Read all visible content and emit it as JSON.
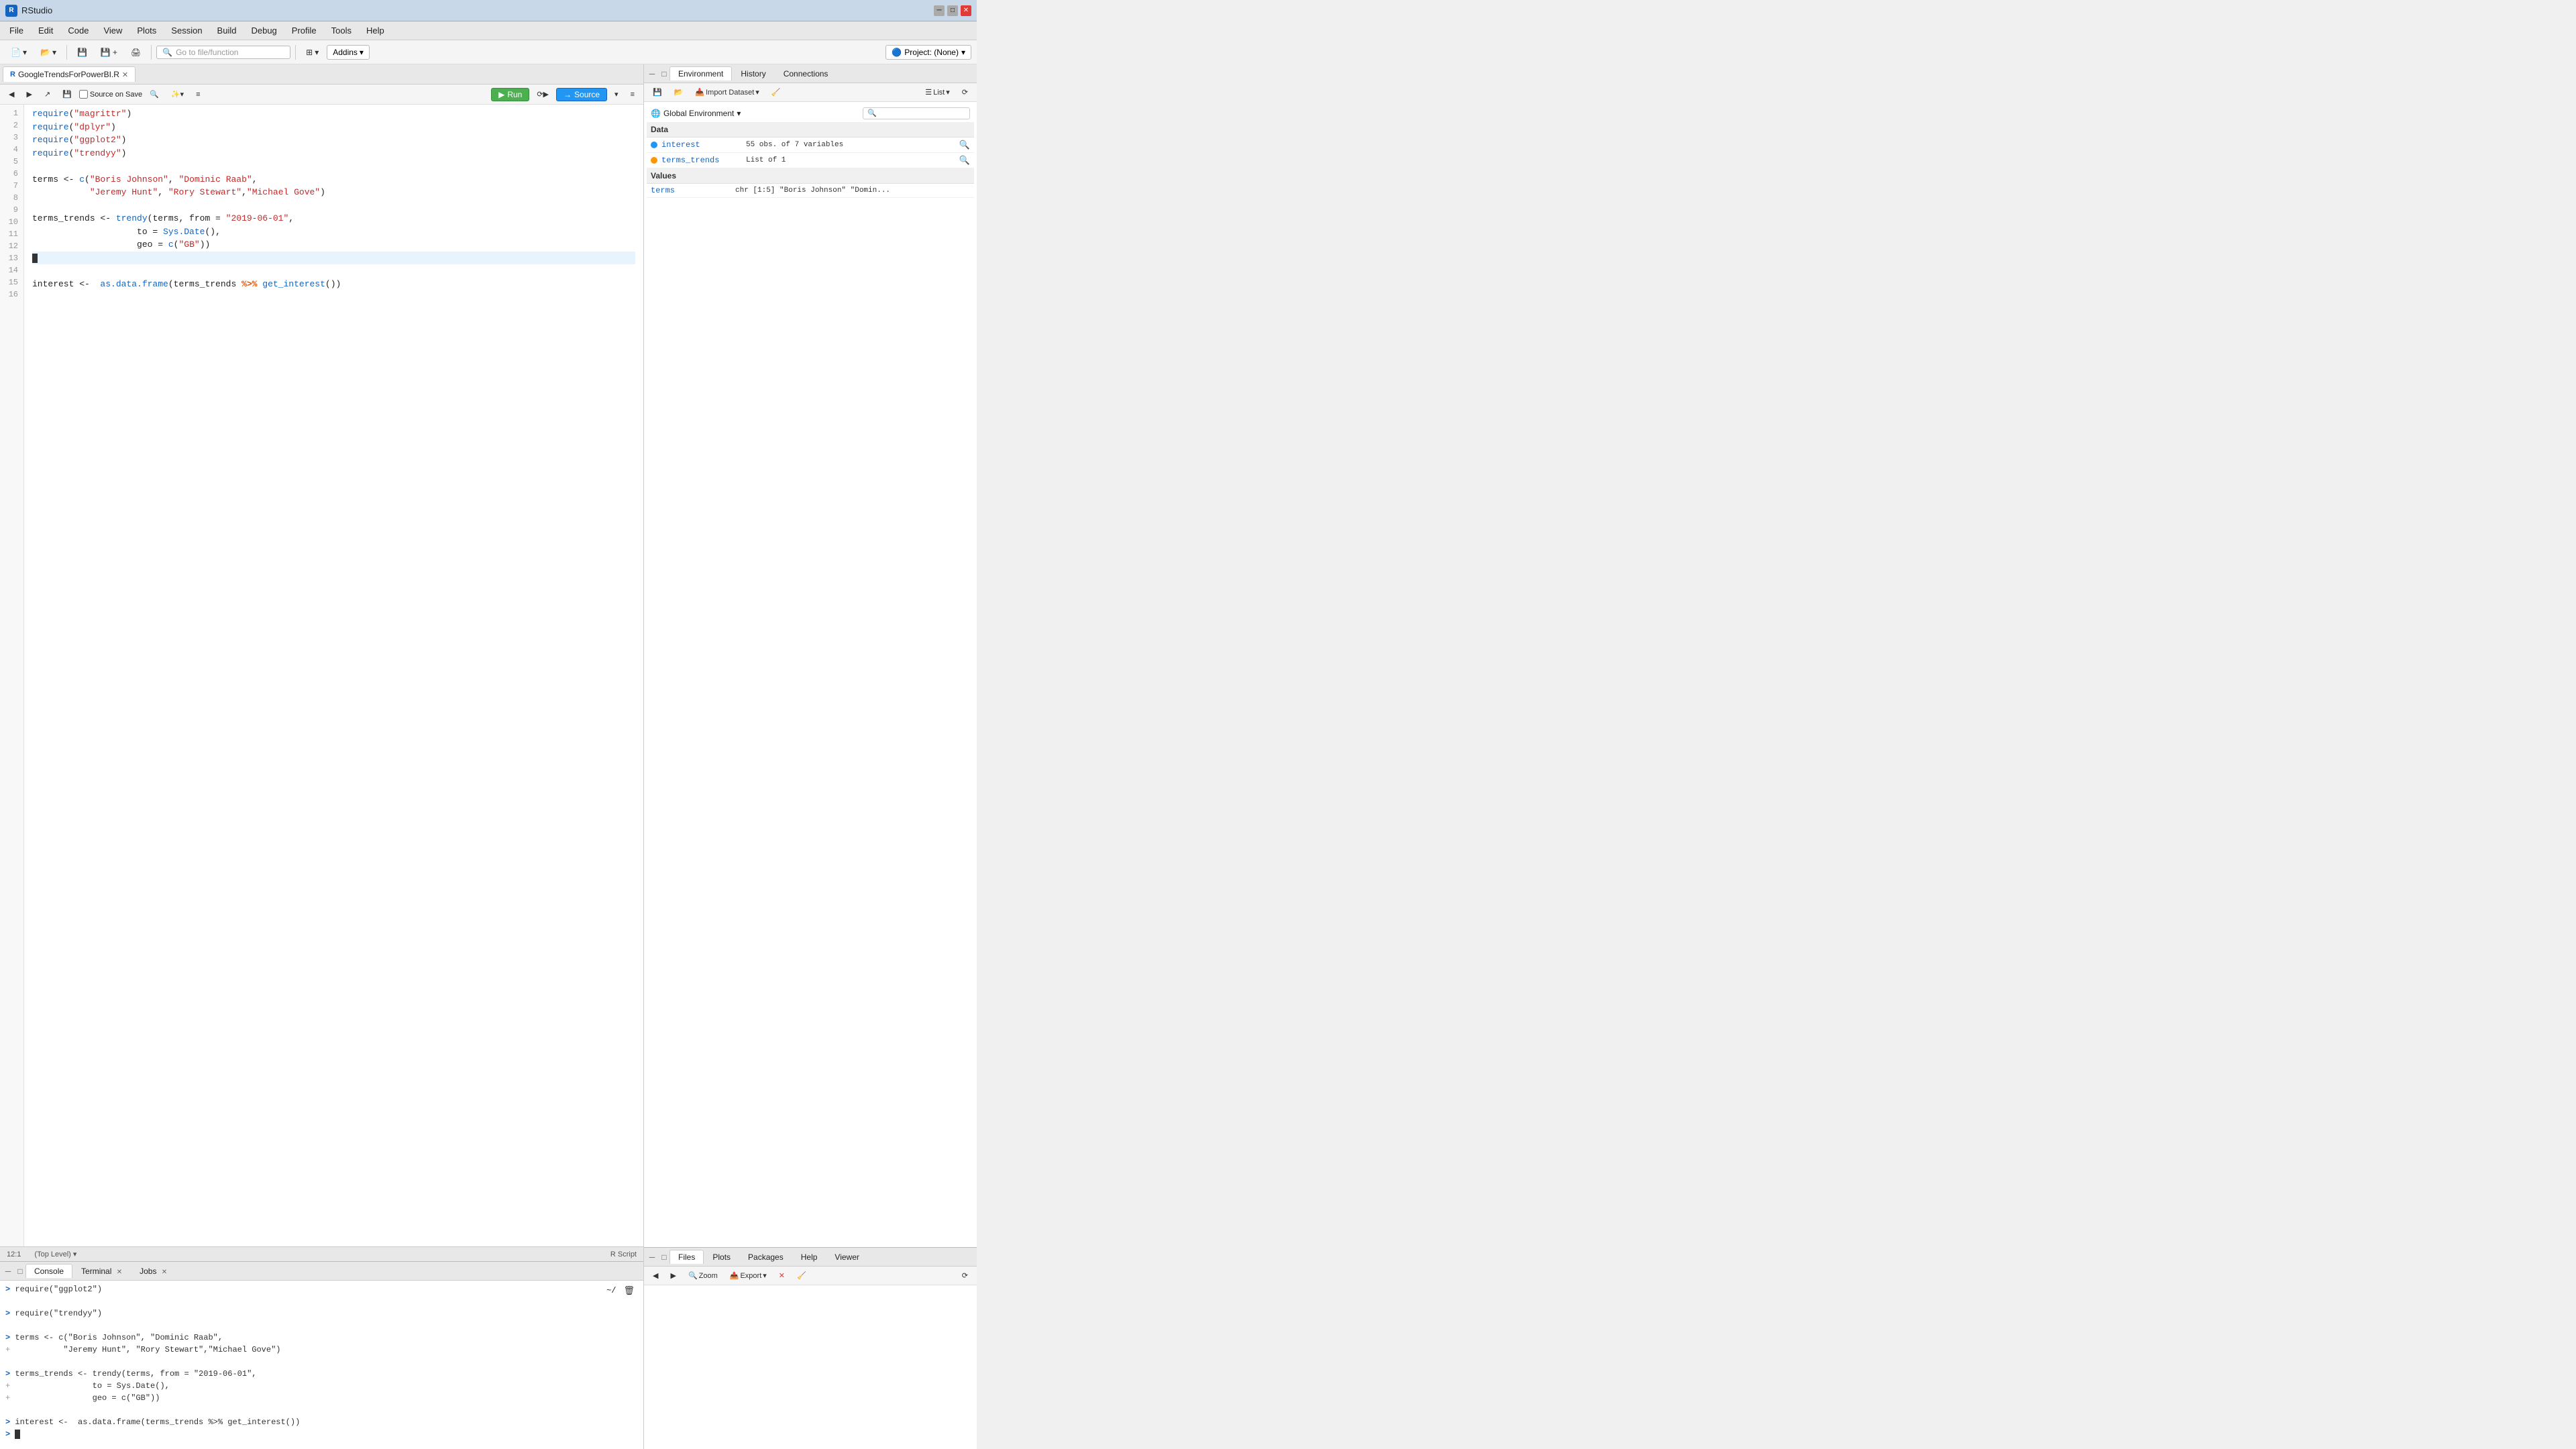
{
  "titleBar": {
    "title": "RStudio",
    "iconLabel": "R"
  },
  "menuBar": {
    "items": [
      "File",
      "Edit",
      "Code",
      "View",
      "Plots",
      "Session",
      "Build",
      "Debug",
      "Profile",
      "Tools",
      "Help"
    ]
  },
  "toolbar": {
    "gotoPlaceholder": "Go to file/function",
    "addins": "Addins",
    "project": "Project: (None)"
  },
  "editor": {
    "tabName": "GoogleTrendsForPowerBI.R",
    "toolbar": {
      "sourceOnSave": "Source on Save",
      "runBtn": "Run",
      "sourceBtn": "Source"
    },
    "lines": [
      {
        "num": 1,
        "code": "require(\"magrittr\")",
        "tokens": [
          {
            "t": "func",
            "v": "require"
          },
          {
            "t": "normal",
            "v": "("
          },
          {
            "t": "str",
            "v": "\"magrittr\""
          },
          {
            "t": "normal",
            "v": ")"
          }
        ]
      },
      {
        "num": 2,
        "code": "require(\"dplyr\")",
        "tokens": [
          {
            "t": "func",
            "v": "require"
          },
          {
            "t": "normal",
            "v": "("
          },
          {
            "t": "str",
            "v": "\"dplyr\""
          },
          {
            "t": "normal",
            "v": ")"
          }
        ]
      },
      {
        "num": 3,
        "code": "require(\"ggplot2\")",
        "tokens": [
          {
            "t": "func",
            "v": "require"
          },
          {
            "t": "normal",
            "v": "("
          },
          {
            "t": "str",
            "v": "\"ggplot2\""
          },
          {
            "t": "normal",
            "v": ")"
          }
        ]
      },
      {
        "num": 4,
        "code": "require(\"trendyy\")",
        "tokens": [
          {
            "t": "func",
            "v": "require"
          },
          {
            "t": "normal",
            "v": "("
          },
          {
            "t": "str",
            "v": "\"trendyy\""
          },
          {
            "t": "normal",
            "v": ")"
          }
        ]
      },
      {
        "num": 5,
        "code": ""
      },
      {
        "num": 6,
        "code": "terms <- c(\"Boris Johnson\", \"Dominic Raab\",",
        "tokens": [
          {
            "t": "assign",
            "v": "terms <- "
          },
          {
            "t": "func",
            "v": "c"
          },
          {
            "t": "normal",
            "v": "("
          },
          {
            "t": "str",
            "v": "\"Boris Johnson\""
          },
          {
            "t": "normal",
            "v": ", "
          },
          {
            "t": "str",
            "v": "\"Dominic Raab\""
          },
          {
            "t": "normal",
            "v": ","
          }
        ]
      },
      {
        "num": 7,
        "code": "         \"Jeremy Hunt\", \"Rory Stewart\",\"Michael Gove\")",
        "tokens": [
          {
            "t": "normal",
            "v": "         "
          },
          {
            "t": "str",
            "v": "\"Jeremy Hunt\""
          },
          {
            "t": "normal",
            "v": ", "
          },
          {
            "t": "str",
            "v": "\"Rory Stewart\""
          },
          {
            "t": "normal",
            "v": ","
          },
          {
            "t": "str",
            "v": "\"Michael Gove\""
          },
          {
            "t": "normal",
            "v": ")"
          }
        ]
      },
      {
        "num": 8,
        "code": ""
      },
      {
        "num": 9,
        "code": "terms_trends <- trendy(terms, from = \"2019-06-01\",",
        "tokens": [
          {
            "t": "assign",
            "v": "terms_trends <- "
          },
          {
            "t": "func",
            "v": "trendy"
          },
          {
            "t": "normal",
            "v": "(terms, from = "
          },
          {
            "t": "str",
            "v": "\"2019-06-01\""
          },
          {
            "t": "normal",
            "v": ","
          }
        ]
      },
      {
        "num": 10,
        "code": "                    to = Sys.Date(),",
        "tokens": [
          {
            "t": "normal",
            "v": "                    to = "
          },
          {
            "t": "func",
            "v": "Sys.Date"
          },
          {
            "t": "normal",
            "v": "(),"
          }
        ]
      },
      {
        "num": 11,
        "code": "                    geo = c(\"GB\"))",
        "tokens": [
          {
            "t": "normal",
            "v": "                    geo = "
          },
          {
            "t": "func",
            "v": "c"
          },
          {
            "t": "normal",
            "v": "("
          },
          {
            "t": "str",
            "v": "\"GB\""
          },
          {
            "t": "normal",
            "v": "))"
          }
        ]
      },
      {
        "num": 12,
        "code": "",
        "cursor": true
      },
      {
        "num": 13,
        "code": ""
      },
      {
        "num": 14,
        "code": "interest <-  as.data.frame(terms_trends %>% get_interest())",
        "tokens": [
          {
            "t": "assign",
            "v": "interest <- "
          },
          {
            "t": "normal",
            "v": " "
          },
          {
            "t": "func",
            "v": "as.data.frame"
          },
          {
            "t": "normal",
            "v": "(terms_trends "
          },
          {
            "t": "pipe",
            "v": "%>%"
          },
          {
            "t": "normal",
            "v": " "
          },
          {
            "t": "func",
            "v": "get_interest"
          },
          {
            "t": "normal",
            "v": "())"
          }
        ]
      },
      {
        "num": 15,
        "code": ""
      },
      {
        "num": 16,
        "code": ""
      }
    ],
    "statusBar": {
      "position": "12:1",
      "level": "(Top Level)",
      "fileType": "R Script"
    }
  },
  "console": {
    "tabs": [
      "Console",
      "Terminal",
      "Jobs"
    ],
    "activeTab": "Console",
    "workdir": "~/",
    "lines": [
      "> require(\"ggplot2\")",
      "",
      "> require(\"trendyy\")",
      "",
      "> terms <- c(\"Boris Johnson\", \"Dominic Raab\",",
      "+           \"Jeremy Hunt\", \"Rory Stewart\",\"Michael Gove\")",
      "",
      "> terms_trends <- trendy(terms, from = \"2019-06-01\",",
      "+                 to = Sys.Date(),",
      "+                 geo = c(\"GB\"))",
      "",
      "> interest <-  as.data.frame(terms_trends %>% get_interest())",
      ">"
    ]
  },
  "environment": {
    "tabs": [
      "Environment",
      "History",
      "Connections"
    ],
    "activeTab": "Environment",
    "toolbar": {
      "importDataset": "Import Dataset",
      "listView": "List"
    },
    "globalEnv": "Global Environment",
    "sections": {
      "data": {
        "header": "Data",
        "items": [
          {
            "name": "interest",
            "value": "55 obs. of 7 variables",
            "hasIcon": true
          },
          {
            "name": "terms_trends",
            "value": "List of 1",
            "hasIcon": true,
            "isOrange": true
          }
        ]
      },
      "values": {
        "header": "Values",
        "items": [
          {
            "name": "terms",
            "value": "chr [1:5] \"Boris Johnson\" \"Domin..."
          }
        ]
      }
    }
  },
  "files": {
    "tabs": [
      "Files",
      "Plots",
      "Packages",
      "Help",
      "Viewer"
    ],
    "activeTab": "Files",
    "toolbar": {
      "back": "←",
      "forward": "→",
      "zoom": "Zoom",
      "export": "Export",
      "removeBtn": "✕"
    }
  }
}
